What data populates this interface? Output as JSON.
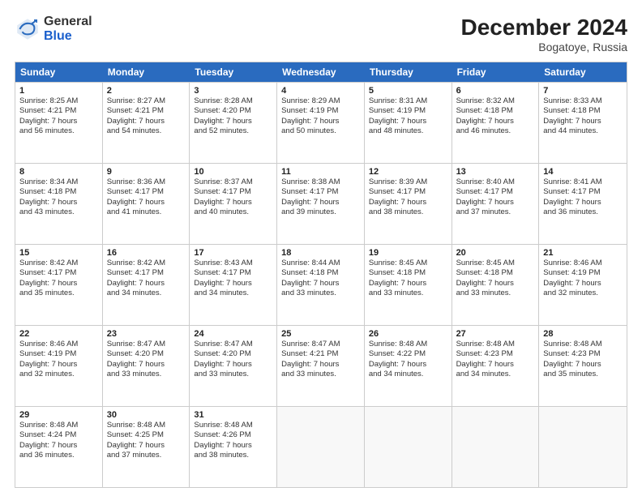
{
  "header": {
    "logo_general": "General",
    "logo_blue": "Blue",
    "title": "December 2024",
    "subtitle": "Bogatoye, Russia"
  },
  "days": [
    "Sunday",
    "Monday",
    "Tuesday",
    "Wednesday",
    "Thursday",
    "Friday",
    "Saturday"
  ],
  "weeks": [
    [
      {
        "day": "1",
        "sunrise": "Sunrise: 8:25 AM",
        "sunset": "Sunset: 4:21 PM",
        "daylight": "Daylight: 7 hours",
        "daylight2": "and 56 minutes."
      },
      {
        "day": "2",
        "sunrise": "Sunrise: 8:27 AM",
        "sunset": "Sunset: 4:21 PM",
        "daylight": "Daylight: 7 hours",
        "daylight2": "and 54 minutes."
      },
      {
        "day": "3",
        "sunrise": "Sunrise: 8:28 AM",
        "sunset": "Sunset: 4:20 PM",
        "daylight": "Daylight: 7 hours",
        "daylight2": "and 52 minutes."
      },
      {
        "day": "4",
        "sunrise": "Sunrise: 8:29 AM",
        "sunset": "Sunset: 4:19 PM",
        "daylight": "Daylight: 7 hours",
        "daylight2": "and 50 minutes."
      },
      {
        "day": "5",
        "sunrise": "Sunrise: 8:31 AM",
        "sunset": "Sunset: 4:19 PM",
        "daylight": "Daylight: 7 hours",
        "daylight2": "and 48 minutes."
      },
      {
        "day": "6",
        "sunrise": "Sunrise: 8:32 AM",
        "sunset": "Sunset: 4:18 PM",
        "daylight": "Daylight: 7 hours",
        "daylight2": "and 46 minutes."
      },
      {
        "day": "7",
        "sunrise": "Sunrise: 8:33 AM",
        "sunset": "Sunset: 4:18 PM",
        "daylight": "Daylight: 7 hours",
        "daylight2": "and 44 minutes."
      }
    ],
    [
      {
        "day": "8",
        "sunrise": "Sunrise: 8:34 AM",
        "sunset": "Sunset: 4:18 PM",
        "daylight": "Daylight: 7 hours",
        "daylight2": "and 43 minutes."
      },
      {
        "day": "9",
        "sunrise": "Sunrise: 8:36 AM",
        "sunset": "Sunset: 4:17 PM",
        "daylight": "Daylight: 7 hours",
        "daylight2": "and 41 minutes."
      },
      {
        "day": "10",
        "sunrise": "Sunrise: 8:37 AM",
        "sunset": "Sunset: 4:17 PM",
        "daylight": "Daylight: 7 hours",
        "daylight2": "and 40 minutes."
      },
      {
        "day": "11",
        "sunrise": "Sunrise: 8:38 AM",
        "sunset": "Sunset: 4:17 PM",
        "daylight": "Daylight: 7 hours",
        "daylight2": "and 39 minutes."
      },
      {
        "day": "12",
        "sunrise": "Sunrise: 8:39 AM",
        "sunset": "Sunset: 4:17 PM",
        "daylight": "Daylight: 7 hours",
        "daylight2": "and 38 minutes."
      },
      {
        "day": "13",
        "sunrise": "Sunrise: 8:40 AM",
        "sunset": "Sunset: 4:17 PM",
        "daylight": "Daylight: 7 hours",
        "daylight2": "and 37 minutes."
      },
      {
        "day": "14",
        "sunrise": "Sunrise: 8:41 AM",
        "sunset": "Sunset: 4:17 PM",
        "daylight": "Daylight: 7 hours",
        "daylight2": "and 36 minutes."
      }
    ],
    [
      {
        "day": "15",
        "sunrise": "Sunrise: 8:42 AM",
        "sunset": "Sunset: 4:17 PM",
        "daylight": "Daylight: 7 hours",
        "daylight2": "and 35 minutes."
      },
      {
        "day": "16",
        "sunrise": "Sunrise: 8:42 AM",
        "sunset": "Sunset: 4:17 PM",
        "daylight": "Daylight: 7 hours",
        "daylight2": "and 34 minutes."
      },
      {
        "day": "17",
        "sunrise": "Sunrise: 8:43 AM",
        "sunset": "Sunset: 4:17 PM",
        "daylight": "Daylight: 7 hours",
        "daylight2": "and 34 minutes."
      },
      {
        "day": "18",
        "sunrise": "Sunrise: 8:44 AM",
        "sunset": "Sunset: 4:18 PM",
        "daylight": "Daylight: 7 hours",
        "daylight2": "and 33 minutes."
      },
      {
        "day": "19",
        "sunrise": "Sunrise: 8:45 AM",
        "sunset": "Sunset: 4:18 PM",
        "daylight": "Daylight: 7 hours",
        "daylight2": "and 33 minutes."
      },
      {
        "day": "20",
        "sunrise": "Sunrise: 8:45 AM",
        "sunset": "Sunset: 4:18 PM",
        "daylight": "Daylight: 7 hours",
        "daylight2": "and 33 minutes."
      },
      {
        "day": "21",
        "sunrise": "Sunrise: 8:46 AM",
        "sunset": "Sunset: 4:19 PM",
        "daylight": "Daylight: 7 hours",
        "daylight2": "and 32 minutes."
      }
    ],
    [
      {
        "day": "22",
        "sunrise": "Sunrise: 8:46 AM",
        "sunset": "Sunset: 4:19 PM",
        "daylight": "Daylight: 7 hours",
        "daylight2": "and 32 minutes."
      },
      {
        "day": "23",
        "sunrise": "Sunrise: 8:47 AM",
        "sunset": "Sunset: 4:20 PM",
        "daylight": "Daylight: 7 hours",
        "daylight2": "and 33 minutes."
      },
      {
        "day": "24",
        "sunrise": "Sunrise: 8:47 AM",
        "sunset": "Sunset: 4:20 PM",
        "daylight": "Daylight: 7 hours",
        "daylight2": "and 33 minutes."
      },
      {
        "day": "25",
        "sunrise": "Sunrise: 8:47 AM",
        "sunset": "Sunset: 4:21 PM",
        "daylight": "Daylight: 7 hours",
        "daylight2": "and 33 minutes."
      },
      {
        "day": "26",
        "sunrise": "Sunrise: 8:48 AM",
        "sunset": "Sunset: 4:22 PM",
        "daylight": "Daylight: 7 hours",
        "daylight2": "and 34 minutes."
      },
      {
        "day": "27",
        "sunrise": "Sunrise: 8:48 AM",
        "sunset": "Sunset: 4:23 PM",
        "daylight": "Daylight: 7 hours",
        "daylight2": "and 34 minutes."
      },
      {
        "day": "28",
        "sunrise": "Sunrise: 8:48 AM",
        "sunset": "Sunset: 4:23 PM",
        "daylight": "Daylight: 7 hours",
        "daylight2": "and 35 minutes."
      }
    ],
    [
      {
        "day": "29",
        "sunrise": "Sunrise: 8:48 AM",
        "sunset": "Sunset: 4:24 PM",
        "daylight": "Daylight: 7 hours",
        "daylight2": "and 36 minutes."
      },
      {
        "day": "30",
        "sunrise": "Sunrise: 8:48 AM",
        "sunset": "Sunset: 4:25 PM",
        "daylight": "Daylight: 7 hours",
        "daylight2": "and 37 minutes."
      },
      {
        "day": "31",
        "sunrise": "Sunrise: 8:48 AM",
        "sunset": "Sunset: 4:26 PM",
        "daylight": "Daylight: 7 hours",
        "daylight2": "and 38 minutes."
      },
      null,
      null,
      null,
      null
    ]
  ]
}
